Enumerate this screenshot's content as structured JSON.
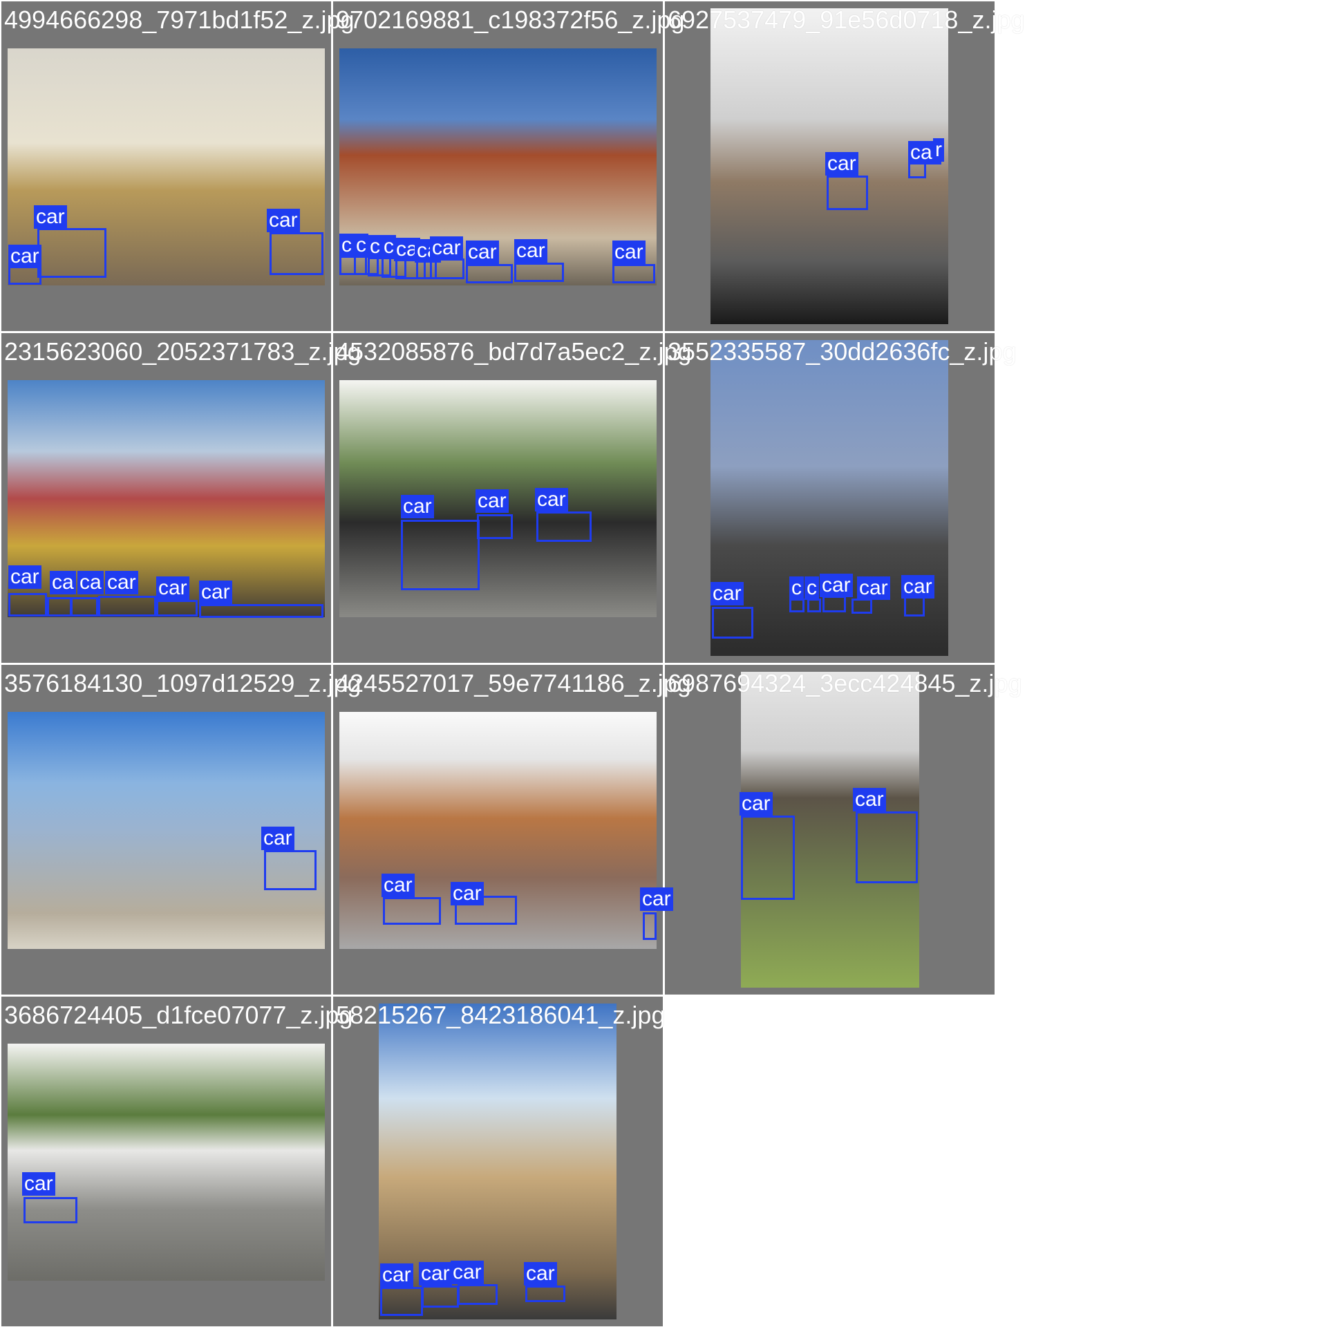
{
  "tiles": [
    {
      "filename": "4994666298_7971bd1f52_z.jpg",
      "detections": [
        "car",
        "car",
        "car"
      ]
    },
    {
      "filename": "9702169881_c198372f56_z.jpg",
      "detections": [
        "c",
        "c",
        "c",
        "c",
        "ca",
        "ca",
        "car",
        "car",
        "car",
        "car"
      ]
    },
    {
      "filename": "6927537479_91e56d0718_z.jpg",
      "detections": [
        "car",
        "car",
        "r"
      ]
    },
    {
      "filename": "2315623060_2052371783_z.jpg",
      "detections": [
        "car",
        "ca",
        "ca",
        "car",
        "car",
        "car"
      ]
    },
    {
      "filename": "4532085876_bd7d7a5ec2_z.jpg",
      "detections": [
        "car",
        "car",
        "car"
      ]
    },
    {
      "filename": "3552335587_30dd2636fc_z.jpg",
      "detections": [
        "car",
        "c",
        "c",
        "car",
        "car",
        "car"
      ]
    },
    {
      "filename": "3576184130_1097d12529_z.jpg",
      "detections": [
        "car"
      ]
    },
    {
      "filename": "4245527017_59e7741186_z.jpg",
      "detections": [
        "car",
        "car",
        "car"
      ]
    },
    {
      "filename": "6987694324_3ecc424845_z.jpg",
      "detections": [
        "car",
        "car"
      ]
    },
    {
      "filename": "3686724405_d1fce07077_z.jpg",
      "detections": [
        "car"
      ]
    },
    {
      "filename": "58215267_8423186041_z.jpg",
      "detections": [
        "car",
        "car",
        "car",
        "car"
      ]
    }
  ],
  "colors": {
    "tile_background": "#767676",
    "box": "#1f3cf0",
    "label_text": "#ffffff",
    "filename_text": "#ffffff"
  }
}
